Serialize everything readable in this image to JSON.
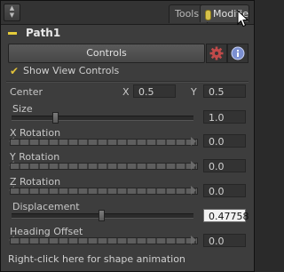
{
  "tabs": {
    "tools": "Tools",
    "modifiers": "Modifiers"
  },
  "tool": {
    "name": "Path1"
  },
  "controls_tab": "Controls",
  "show_view_controls": "Show View Controls",
  "center": {
    "label": "Center",
    "x_label": "X",
    "x_value": "0.5",
    "y_label": "Y",
    "y_value": "0.5"
  },
  "size": {
    "label": "Size",
    "value": "1.0"
  },
  "x_rotation": {
    "label": "X Rotation",
    "value": "0.0"
  },
  "y_rotation": {
    "label": "Y Rotation",
    "value": "0.0"
  },
  "z_rotation": {
    "label": "Z Rotation",
    "value": "0.0"
  },
  "displacement": {
    "label": "Displacement",
    "value": "0.47758"
  },
  "heading_offset": {
    "label": "Heading Offset",
    "value": "0.0"
  },
  "footer": "Right-click here for shape animation",
  "icons": [
    "collapse-arrows-icon",
    "modifier-pill-icon",
    "mouse-cursor-icon",
    "gear-icon",
    "info-icon",
    "checkmark-icon"
  ],
  "colors": {
    "accent": "#e5cc3a",
    "gear": "#c04a4a",
    "info": "#7b8fd1",
    "background": "#3d3d3d"
  }
}
